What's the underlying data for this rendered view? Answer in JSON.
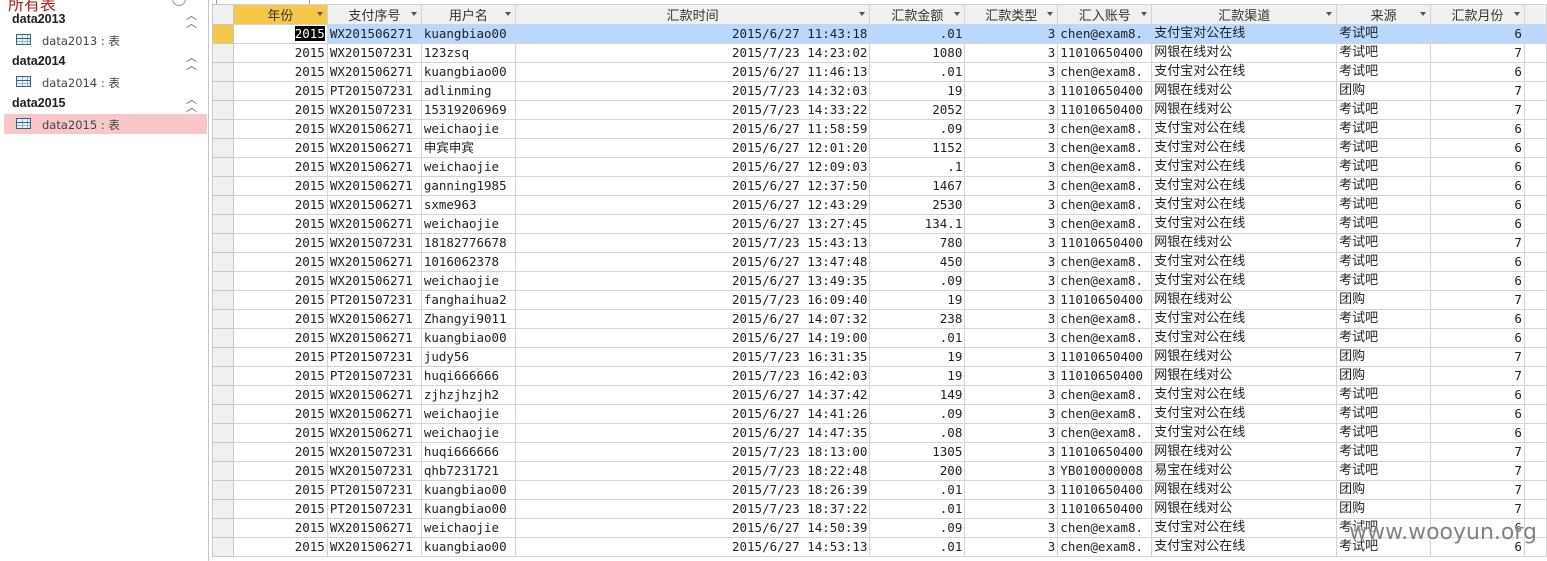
{
  "nav": {
    "title": "所有表",
    "groups": [
      {
        "label": "data2013",
        "item": "data2013 : 表"
      },
      {
        "label": "data2014",
        "item": "data2014 : 表"
      },
      {
        "label": "data2015",
        "item": "data2015 : 表"
      }
    ]
  },
  "sheet": {
    "columns": [
      "年份",
      "支付序号",
      "用户名",
      "汇款时间",
      "汇款金额",
      "汇款类型",
      "汇入账号",
      "汇款渠道",
      "来源",
      "汇款月份"
    ],
    "rows": [
      [
        "2015",
        "WX201506271",
        "kuangbiao00",
        "2015/6/27 11:43:18",
        ".01",
        "3",
        "chen@exam8.",
        "支付宝对公在线",
        "考试吧",
        "6"
      ],
      [
        "2015",
        "WX201507231",
        "123zsq",
        "2015/7/23 14:23:02",
        "1080",
        "3",
        "11010650400",
        "网银在线对公",
        "考试吧",
        "7"
      ],
      [
        "2015",
        "WX201506271",
        "kuangbiao00",
        "2015/6/27 11:46:13",
        ".01",
        "3",
        "chen@exam8.",
        "支付宝对公在线",
        "考试吧",
        "6"
      ],
      [
        "2015",
        "PT201507231",
        "adlinming",
        "2015/7/23 14:32:03",
        "19",
        "3",
        "11010650400",
        "网银在线对公",
        "团购",
        "7"
      ],
      [
        "2015",
        "WX201507231",
        "15319206969",
        "2015/7/23 14:33:22",
        "2052",
        "3",
        "11010650400",
        "网银在线对公",
        "考试吧",
        "7"
      ],
      [
        "2015",
        "WX201506271",
        "weichaojie",
        "2015/6/27 11:58:59",
        ".09",
        "3",
        "chen@exam8.",
        "支付宝对公在线",
        "考试吧",
        "6"
      ],
      [
        "2015",
        "WX201506271",
        "申宾申宾",
        "2015/6/27 12:01:20",
        "1152",
        "3",
        "chen@exam8.",
        "支付宝对公在线",
        "考试吧",
        "6"
      ],
      [
        "2015",
        "WX201506271",
        "weichaojie",
        "2015/6/27 12:09:03",
        ".1",
        "3",
        "chen@exam8.",
        "支付宝对公在线",
        "考试吧",
        "6"
      ],
      [
        "2015",
        "WX201506271",
        "ganning1985",
        "2015/6/27 12:37:50",
        "1467",
        "3",
        "chen@exam8.",
        "支付宝对公在线",
        "考试吧",
        "6"
      ],
      [
        "2015",
        "WX201506271",
        "sxme963",
        "2015/6/27 12:43:29",
        "2530",
        "3",
        "chen@exam8.",
        "支付宝对公在线",
        "考试吧",
        "6"
      ],
      [
        "2015",
        "WX201506271",
        "weichaojie",
        "2015/6/27 13:27:45",
        "134.1",
        "3",
        "chen@exam8.",
        "支付宝对公在线",
        "考试吧",
        "6"
      ],
      [
        "2015",
        "WX201507231",
        "18182776678",
        "2015/7/23 15:43:13",
        "780",
        "3",
        "11010650400",
        "网银在线对公",
        "考试吧",
        "7"
      ],
      [
        "2015",
        "WX201506271",
        "1016062378",
        "2015/6/27 13:47:48",
        "450",
        "3",
        "chen@exam8.",
        "支付宝对公在线",
        "考试吧",
        "6"
      ],
      [
        "2015",
        "WX201506271",
        "weichaojie",
        "2015/6/27 13:49:35",
        ".09",
        "3",
        "chen@exam8.",
        "支付宝对公在线",
        "考试吧",
        "6"
      ],
      [
        "2015",
        "PT201507231",
        "fanghaihua2",
        "2015/7/23 16:09:40",
        "19",
        "3",
        "11010650400",
        "网银在线对公",
        "团购",
        "7"
      ],
      [
        "2015",
        "WX201506271",
        "Zhangyi9011",
        "2015/6/27 14:07:32",
        "238",
        "3",
        "chen@exam8.",
        "支付宝对公在线",
        "考试吧",
        "6"
      ],
      [
        "2015",
        "WX201506271",
        "kuangbiao00",
        "2015/6/27 14:19:00",
        ".01",
        "3",
        "chen@exam8.",
        "支付宝对公在线",
        "考试吧",
        "6"
      ],
      [
        "2015",
        "PT201507231",
        "judy56",
        "2015/7/23 16:31:35",
        "19",
        "3",
        "11010650400",
        "网银在线对公",
        "团购",
        "7"
      ],
      [
        "2015",
        "PT201507231",
        "huqi666666",
        "2015/7/23 16:42:03",
        "19",
        "3",
        "11010650400",
        "网银在线对公",
        "团购",
        "7"
      ],
      [
        "2015",
        "WX201506271",
        "zjhzjhzjh2",
        "2015/6/27 14:37:42",
        "149",
        "3",
        "chen@exam8.",
        "支付宝对公在线",
        "考试吧",
        "6"
      ],
      [
        "2015",
        "WX201506271",
        "weichaojie",
        "2015/6/27 14:41:26",
        ".09",
        "3",
        "chen@exam8.",
        "支付宝对公在线",
        "考试吧",
        "6"
      ],
      [
        "2015",
        "WX201506271",
        "weichaojie",
        "2015/6/27 14:47:35",
        ".08",
        "3",
        "chen@exam8.",
        "支付宝对公在线",
        "考试吧",
        "6"
      ],
      [
        "2015",
        "WX201507231",
        "huqi666666",
        "2015/7/23 18:13:00",
        "1305",
        "3",
        "11010650400",
        "网银在线对公",
        "考试吧",
        "7"
      ],
      [
        "2015",
        "WX201507231",
        "qhb7231721",
        "2015/7/23 18:22:48",
        "200",
        "3",
        "YB010000008",
        "易宝在线对公",
        "考试吧",
        "7"
      ],
      [
        "2015",
        "PT201507231",
        "kuangbiao00",
        "2015/7/23 18:26:39",
        ".01",
        "3",
        "11010650400",
        "网银在线对公",
        "团购",
        "7"
      ],
      [
        "2015",
        "PT201507231",
        "kuangbiao00",
        "2015/7/23 18:37:22",
        ".01",
        "3",
        "11010650400",
        "网银在线对公",
        "团购",
        "7"
      ],
      [
        "2015",
        "WX201506271",
        "weichaojie",
        "2015/6/27 14:50:39",
        ".09",
        "3",
        "chen@exam8.",
        "支付宝对公在线",
        "考试吧",
        "6"
      ],
      [
        "2015",
        "WX201506271",
        "kuangbiao00",
        "2015/6/27 14:53:13",
        ".01",
        "3",
        "chen@exam8.",
        "支付宝对公在线",
        "考试吧",
        "6"
      ]
    ]
  },
  "watermark": "www.wooyun.org"
}
